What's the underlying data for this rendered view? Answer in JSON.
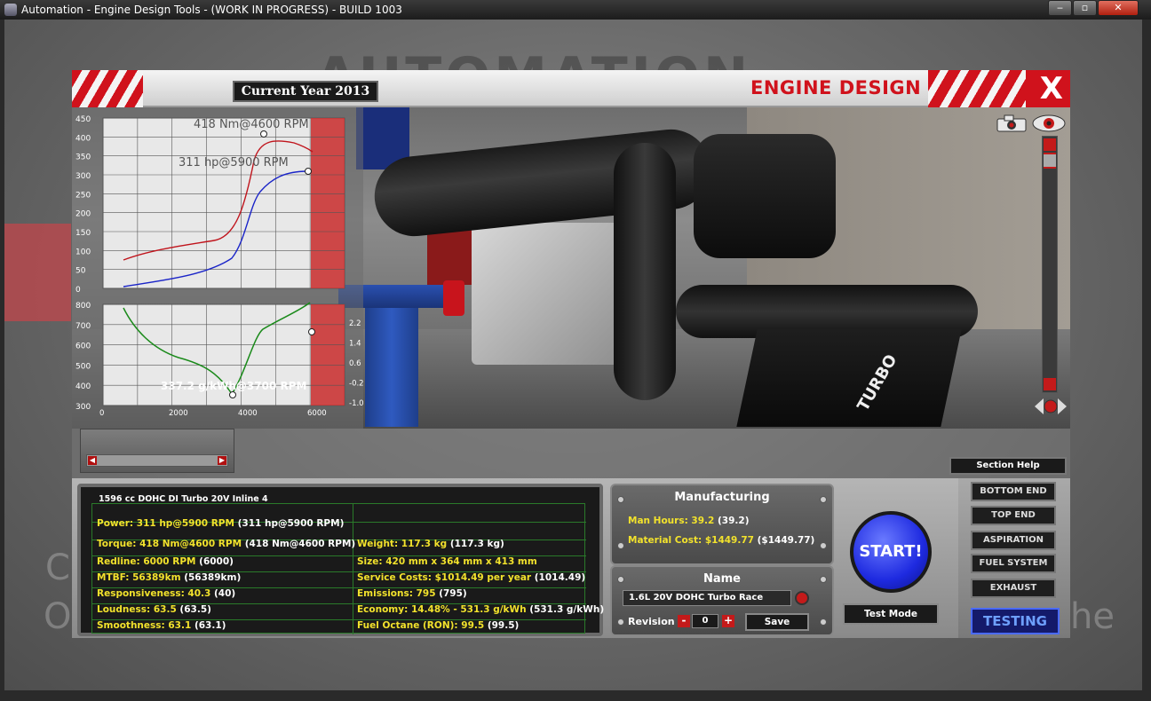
{
  "window": {
    "title": "Automation - Engine Design Tools - (WORK IN PROGRESS) - BUILD 1003",
    "minimize_glyph": "‒",
    "maximize_glyph": "▫",
    "close_glyph": "✕"
  },
  "header": {
    "year": "Current Year 2013",
    "title": "ENGINE DESIGN",
    "close_glyph": "X"
  },
  "viewport": {
    "engine_label": "TURBO"
  },
  "graphs": {
    "top": {
      "y_ticks": [
        "450",
        "400",
        "350",
        "300",
        "250",
        "200",
        "150",
        "100",
        "50",
        "0"
      ],
      "torque_label": "418 Nm@4600 RPM",
      "power_label": "311 hp@5900 RPM",
      "torque_color": "#c0141c",
      "power_color": "#1a24c8"
    },
    "bottom": {
      "y_ticks": [
        "800",
        "700",
        "600",
        "500",
        "400",
        "300"
      ],
      "right_ticks": [
        "2.2",
        "1.4",
        "0.6",
        "-0.2",
        "-1.0"
      ],
      "x_ticks": [
        "0",
        "2000",
        "4000",
        "6000"
      ],
      "bsfc_label": "337.2 g/kWh@3700 RPM",
      "bsfc_color": "#1a8a1a"
    },
    "redline_color": "#c82a2a"
  },
  "section_help": "Section Help",
  "stats": {
    "header": "1596 cc DOHC DI Turbo 20V Inline 4",
    "left": [
      {
        "label": "Power: 311 hp@5900 RPM",
        "value": "(311 hp@5900 RPM)"
      },
      {
        "label": "Torque: 418 Nm@4600 RPM",
        "value": "(418 Nm@4600 RPM)"
      },
      {
        "label": "Redline: 6000 RPM",
        "value": "(6000)"
      },
      {
        "label": "MTBF: 56389km",
        "value": "(56389km)"
      },
      {
        "label": "Responsiveness: 40.3",
        "value": "(40)"
      },
      {
        "label": "Loudness: 63.5",
        "value": "(63.5)"
      },
      {
        "label": "Smoothness: 63.1",
        "value": "(63.1)"
      }
    ],
    "right": [
      {
        "label": "Weight: 117.3 kg",
        "value": "(117.3 kg)"
      },
      {
        "label": "Size: 420 mm x 364 mm x 413 mm",
        "value": ""
      },
      {
        "label": "Service Costs: $1014.49 per year",
        "value": "(1014.49)"
      },
      {
        "label": "Emissions: 795",
        "value": "(795)"
      },
      {
        "label": "Economy: 14.48% - 531.3 g/kWh",
        "value": "(531.3 g/kWh)"
      },
      {
        "label": "Fuel Octane (RON): 99.5",
        "value": "(99.5)"
      }
    ]
  },
  "manufacturing": {
    "title": "Manufacturing",
    "man_hours": {
      "label": "Man Hours: 39.2",
      "value": "(39.2)"
    },
    "material_cost": {
      "label": "Material Cost: $1449.77",
      "value": "($1449.77)"
    }
  },
  "name_panel": {
    "title": "Name",
    "name_value": "1.6L 20V DOHC Turbo Race",
    "revision_label": "Revision",
    "revision_value": "0",
    "minus": "-",
    "plus": "+",
    "save": "Save"
  },
  "start_button": "START!",
  "test_mode": "Test Mode",
  "nav": {
    "items": [
      "BOTTOM END",
      "TOP END",
      "ASPIRATION",
      "FUEL SYSTEM",
      "EXHAUST"
    ],
    "active": "TESTING"
  },
  "background": {
    "logo_text": "AUTOMATION",
    "left_c": "C",
    "left_o": "O",
    "right_he": "he"
  }
}
